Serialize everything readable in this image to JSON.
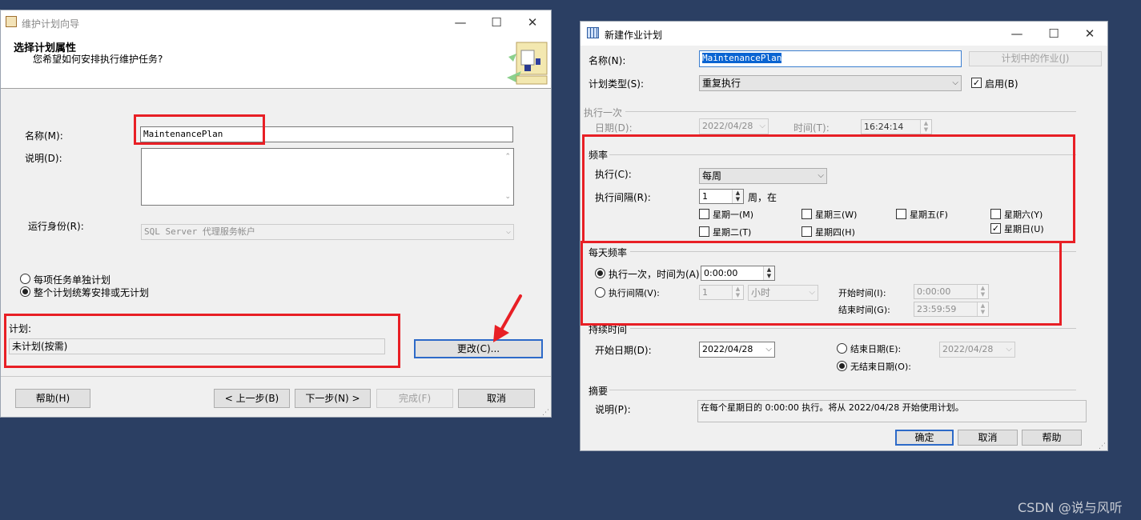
{
  "wizard": {
    "title": "维护计划向导",
    "header_title": "选择计划属性",
    "header_subtitle": "您希望如何安排执行维护任务?",
    "name_label": "名称(M):",
    "name_value": "MaintenancePlan",
    "desc_label": "说明(D):",
    "run_as_label": "运行身份(R):",
    "run_as_value": "SQL Server 代理服务帐户",
    "radio_separate": "每项任务单独计划",
    "radio_whole": "整个计划统筹安排或无计划",
    "schedule_label": "计划:",
    "schedule_value": "未计划(按需)",
    "change_button": "更改(C)...",
    "help_button": "帮助(H)",
    "back_button": "< 上一步(B)",
    "next_button": "下一步(N) >",
    "finish_button": "完成(F)",
    "cancel_button": "取消"
  },
  "job": {
    "title": "新建作业计划",
    "name_label": "名称(N):",
    "name_value": "MaintenancePlan",
    "jobs_button": "计划中的作业(J)",
    "type_label": "计划类型(S):",
    "type_value": "重复执行",
    "enabled_label": "启用(B)",
    "once_section": "执行一次",
    "date_label": "日期(D):",
    "date_value": "2022/04/28",
    "time_label": "时间(T):",
    "time_value": "16:24:14",
    "freq_section": "频率",
    "exec_label": "执行(C):",
    "exec_value": "每周",
    "interval_label": "执行间隔(R):",
    "interval_value": "1",
    "interval_unit": "周，在",
    "days": {
      "mon": "星期一(M)",
      "wed": "星期三(W)",
      "fri": "星期五(F)",
      "sat": "星期六(Y)",
      "tue": "星期二(T)",
      "thu": "星期四(H)",
      "sun": "星期日(U)"
    },
    "daily_section": "每天频率",
    "once_at_label": "执行一次，时间为(A):",
    "once_at_value": "0:00:00",
    "every_label": "执行间隔(V):",
    "every_value": "1",
    "every_unit": "小时",
    "start_time_label": "开始时间(I):",
    "start_time_value": "0:00:00",
    "end_time_label": "结束时间(G):",
    "end_time_value": "23:59:59",
    "duration_section": "持续时间",
    "start_date_label": "开始日期(D):",
    "start_date_value": "2022/04/28",
    "end_date_label": "结束日期(E):",
    "end_date_value": "2022/04/28",
    "no_end_label": "无结束日期(O):",
    "summary_section": "摘要",
    "summary_desc_label": "说明(P):",
    "summary_text": "在每个星期日的 0:00:00 执行。将从 2022/04/28 开始使用计划。",
    "ok_button": "确定",
    "cancel_button": "取消",
    "help_button": "帮助"
  },
  "watermark": "CSDN @说与风听",
  "colors": {
    "desktop": "#2b3f63",
    "highlight": "#e81f25",
    "selection": "#0a64d2"
  }
}
